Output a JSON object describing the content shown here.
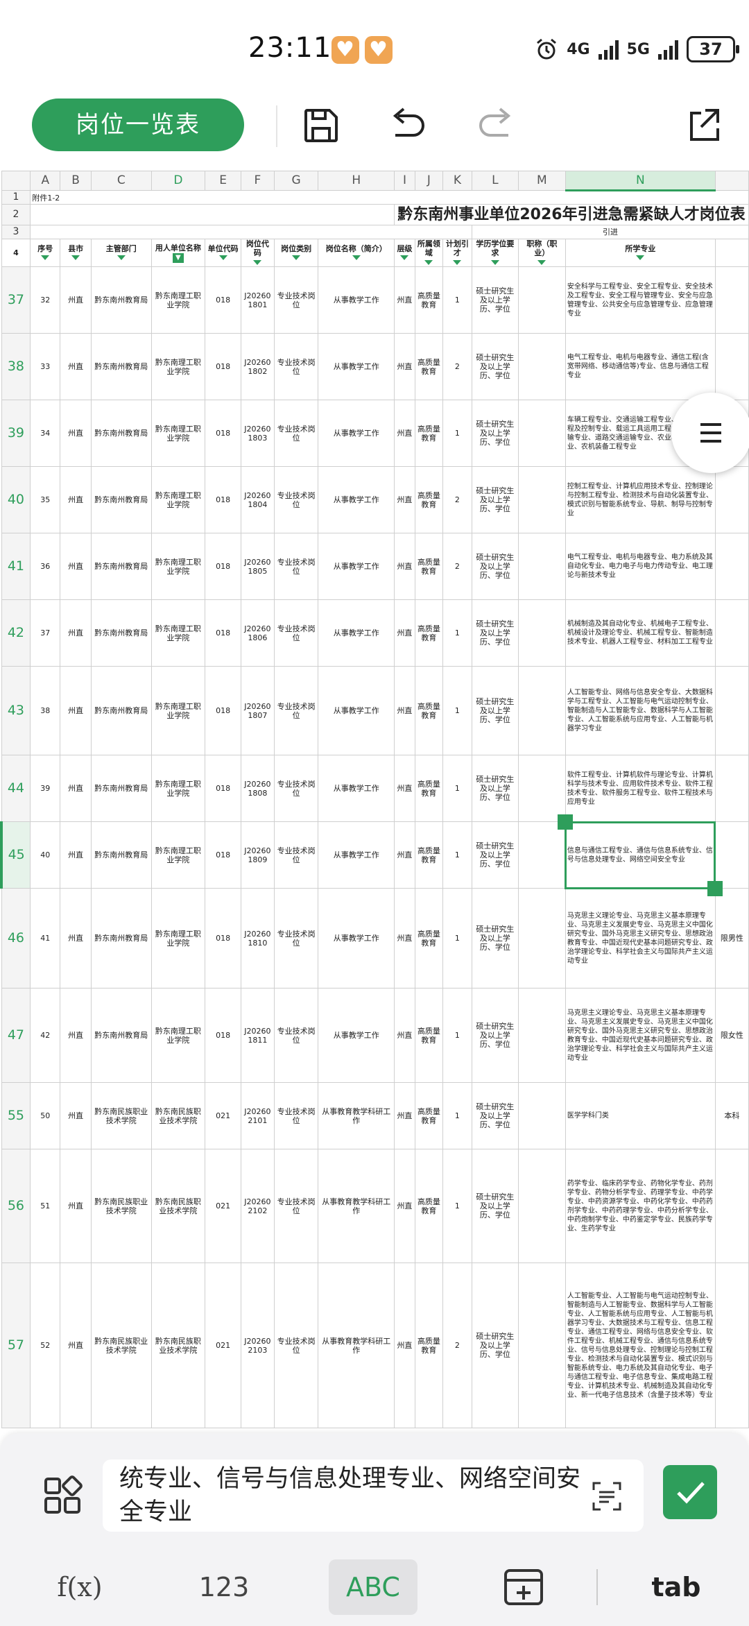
{
  "status_bar": {
    "time": "23:11",
    "network1": "4G",
    "network2": "5G",
    "battery": "37"
  },
  "toolbar": {
    "title_button": "岗位一览表"
  },
  "sheet": {
    "columns": [
      "A",
      "B",
      "C",
      "D",
      "E",
      "F",
      "G",
      "H",
      "I",
      "J",
      "K",
      "L",
      "M",
      "N"
    ],
    "attachment": "附件1-2",
    "title": "黔东南州事业单位2026年引进急需紧缺人才岗位表",
    "group_header": "引进",
    "headers": [
      "序号",
      "县市",
      "主管部门",
      "用人单位名称",
      "单位代码",
      "岗位代码",
      "岗位类别",
      "岗位名称（简介）",
      "层级",
      "所属领域",
      "计划引才",
      "学历学位要求",
      "职称（职业）",
      "所学专业"
    ],
    "rows": [
      {
        "row": "37",
        "seq": "32",
        "county": "州直",
        "dept": "黔东南州教育局",
        "unit": "黔东南理工职业学院",
        "ucode": "018",
        "pcode": "J202601801",
        "ptype": "专业技术岗位",
        "pname": "从事教学工作",
        "level": "州直",
        "field": "高质量教育",
        "num": "1",
        "edu": "硕士研究生及以上学历、学位",
        "title": "",
        "major": "安全科学与工程专业、安全工程专业、安全技术及工程专业、安全工程与管理专业、安全与应急管理专业、公共安全与应急管理专业、应急管理专业",
        "extra": ""
      },
      {
        "row": "38",
        "seq": "33",
        "county": "州直",
        "dept": "黔东南州教育局",
        "unit": "黔东南理工职业学院",
        "ucode": "018",
        "pcode": "J202601802",
        "ptype": "专业技术岗位",
        "pname": "从事教学工作",
        "level": "州直",
        "field": "高质量教育",
        "num": "2",
        "edu": "硕士研究生及以上学历、学位",
        "title": "",
        "major": "电气工程专业、电机与电器专业、通信工程(含宽带网络、移动通信等)专业、信息与通信工程专业",
        "extra": ""
      },
      {
        "row": "39",
        "seq": "34",
        "county": "州直",
        "dept": "黔东南州教育局",
        "unit": "黔东南理工职业学院",
        "ucode": "018",
        "pcode": "J202601803",
        "ptype": "专业技术岗位",
        "pname": "从事教学工作",
        "level": "州直",
        "field": "高质量教育",
        "num": "1",
        "edu": "硕士研究生及以上学历、学位",
        "title": "",
        "major": "车辆工程专业、交通运输工程专业、交通信息工程及控制专业、载运工具运用工程专业、交通运输专业、道路交通运输专业、农业机械化工程专业、农机装备工程专业",
        "extra": ""
      },
      {
        "row": "40",
        "seq": "35",
        "county": "州直",
        "dept": "黔东南州教育局",
        "unit": "黔东南理工职业学院",
        "ucode": "018",
        "pcode": "J202601804",
        "ptype": "专业技术岗位",
        "pname": "从事教学工作",
        "level": "州直",
        "field": "高质量教育",
        "num": "2",
        "edu": "硕士研究生及以上学历、学位",
        "title": "",
        "major": "控制工程专业、计算机应用技术专业、控制理论与控制工程专业、检测技术与自动化装置专业、模式识别与智能系统专业、导航、制导与控制专业",
        "extra": ""
      },
      {
        "row": "41",
        "seq": "36",
        "county": "州直",
        "dept": "黔东南州教育局",
        "unit": "黔东南理工职业学院",
        "ucode": "018",
        "pcode": "J202601805",
        "ptype": "专业技术岗位",
        "pname": "从事教学工作",
        "level": "州直",
        "field": "高质量教育",
        "num": "2",
        "edu": "硕士研究生及以上学历、学位",
        "title": "",
        "major": "电气工程专业、电机与电器专业、电力系统及其自动化专业、电力电子与电力传动专业、电工理论与新技术专业",
        "extra": ""
      },
      {
        "row": "42",
        "seq": "37",
        "county": "州直",
        "dept": "黔东南州教育局",
        "unit": "黔东南理工职业学院",
        "ucode": "018",
        "pcode": "J202601806",
        "ptype": "专业技术岗位",
        "pname": "从事教学工作",
        "level": "州直",
        "field": "高质量教育",
        "num": "1",
        "edu": "硕士研究生及以上学历、学位",
        "title": "",
        "major": "机械制造及其自动化专业、机械电子工程专业、机械设计及理论专业、机械工程专业、智能制造技术专业、机器人工程专业、材料加工工程专业",
        "extra": ""
      },
      {
        "row": "43",
        "seq": "38",
        "county": "州直",
        "dept": "黔东南州教育局",
        "unit": "黔东南理工职业学院",
        "ucode": "018",
        "pcode": "J202601807",
        "ptype": "专业技术岗位",
        "pname": "从事教学工作",
        "level": "州直",
        "field": "高质量教育",
        "num": "1",
        "edu": "硕士研究生及以上学历、学位",
        "title": "",
        "major": "人工智能专业、网络与信息安全专业、大数据科学与工程专业、人工智能与电气运动控制专业、智能制造与人工智能专业、数据科学与人工智能专业、人工智能系统与应用专业、人工智能与机器学习专业",
        "extra": ""
      },
      {
        "row": "44",
        "seq": "39",
        "county": "州直",
        "dept": "黔东南州教育局",
        "unit": "黔东南理工职业学院",
        "ucode": "018",
        "pcode": "J202601808",
        "ptype": "专业技术岗位",
        "pname": "从事教学工作",
        "level": "州直",
        "field": "高质量教育",
        "num": "1",
        "edu": "硕士研究生及以上学历、学位",
        "title": "",
        "major": "软件工程专业、计算机软件与理论专业、计算机科学与技术专业、应用软件技术专业、软件工程技术专业、软件服务工程专业、软件工程技术与应用专业",
        "extra": ""
      },
      {
        "row": "45",
        "seq": "40",
        "county": "州直",
        "dept": "黔东南州教育局",
        "unit": "黔东南理工职业学院",
        "ucode": "018",
        "pcode": "J202601809",
        "ptype": "专业技术岗位",
        "pname": "从事教学工作",
        "level": "州直",
        "field": "高质量教育",
        "num": "1",
        "edu": "硕士研究生及以上学历、学位",
        "title": "",
        "major": "信息与通信工程专业、通信与信息系统专业、信号与信息处理专业、网络空间安全专业",
        "extra": "",
        "selected": true
      },
      {
        "row": "46",
        "seq": "41",
        "county": "州直",
        "dept": "黔东南州教育局",
        "unit": "黔东南理工职业学院",
        "ucode": "018",
        "pcode": "J202601810",
        "ptype": "专业技术岗位",
        "pname": "从事教学工作",
        "level": "州直",
        "field": "高质量教育",
        "num": "1",
        "edu": "硕士研究生及以上学历、学位",
        "title": "",
        "major": "马克思主义理论专业、马克思主义基本原理专业、马克思主义发展史专业、马克思主义中国化研究专业、国外马克思主义研究专业、思想政治教育专业、中国近现代史基本问题研究专业、政治学理论专业、科学社会主义与国际共产主义运动专业",
        "extra": "限男性"
      },
      {
        "row": "47",
        "seq": "42",
        "county": "州直",
        "dept": "黔东南州教育局",
        "unit": "黔东南理工职业学院",
        "ucode": "018",
        "pcode": "J202601811",
        "ptype": "专业技术岗位",
        "pname": "从事教学工作",
        "level": "州直",
        "field": "高质量教育",
        "num": "1",
        "edu": "硕士研究生及以上学历、学位",
        "title": "",
        "major": "马克思主义理论专业、马克思主义基本原理专业、马克思主义发展史专业、马克思主义中国化研究专业、国外马克思主义研究专业、思想政治教育专业、中国近现代史基本问题研究专业、政治学理论专业、科学社会主义与国际共产主义运动专业",
        "extra": "限女性"
      },
      {
        "row": "55",
        "seq": "50",
        "county": "州直",
        "dept": "黔东南民族职业技术学院",
        "unit": "黔东南民族职业技术学院",
        "ucode": "021",
        "pcode": "J202602101",
        "ptype": "专业技术岗位",
        "pname": "从事教育教学科研工作",
        "level": "州直",
        "field": "高质量教育",
        "num": "1",
        "edu": "硕士研究生及以上学历、学位",
        "title": "",
        "major": "医学学科门类",
        "extra": "本科"
      },
      {
        "row": "56",
        "seq": "51",
        "county": "州直",
        "dept": "黔东南民族职业技术学院",
        "unit": "黔东南民族职业技术学院",
        "ucode": "021",
        "pcode": "J202602102",
        "ptype": "专业技术岗位",
        "pname": "从事教育教学科研工作",
        "level": "州直",
        "field": "高质量教育",
        "num": "1",
        "edu": "硕士研究生及以上学历、学位",
        "title": "",
        "major": "药学专业、临床药学专业、药物化学专业、药剂学专业、药物分析学专业、药理学专业、中药学专业、中药资源学专业、中药化学专业、中药药剂学专业、中药药理学专业、中药分析学专业、中药炮制学专业、中药鉴定学专业、民族药学专业、生药学专业",
        "extra": ""
      },
      {
        "row": "57",
        "seq": "52",
        "county": "州直",
        "dept": "黔东南民族职业技术学院",
        "unit": "黔东南民族职业技术学院",
        "ucode": "021",
        "pcode": "J202602103",
        "ptype": "专业技术岗位",
        "pname": "从事教育教学科研工作",
        "level": "州直",
        "field": "高质量教育",
        "num": "2",
        "edu": "硕士研究生及以上学历、学位",
        "title": "",
        "major": "人工智能专业、人工智能与电气运动控制专业、智能制造与人工智能专业、数据科学与人工智能专业、人工智能系统与应用专业、人工智能与机器学习专业、大数据技术与工程专业、信息工程专业、通信工程专业、网络与信息安全专业、软件工程专业、机械工程专业、通信与信息系统专业、信号与信息处理专业、控制理论与控制工程专业、检测技术与自动化装置专业、模式识别与智能系统专业、电力系统及其自动化专业、电子与通信工程专业、电子信息专业、集成电路工程专业、计算机技术专业、机械制造及其自动化专业、新一代电子信息技术（含量子技术等）专业",
        "extra": ""
      }
    ]
  },
  "edit_bar": {
    "content": "统专业、信号与信息处理专业、网络空间安全专业"
  },
  "keyboard_tabs": [
    "f(x)",
    "123",
    "ABC",
    "",
    "tab"
  ]
}
